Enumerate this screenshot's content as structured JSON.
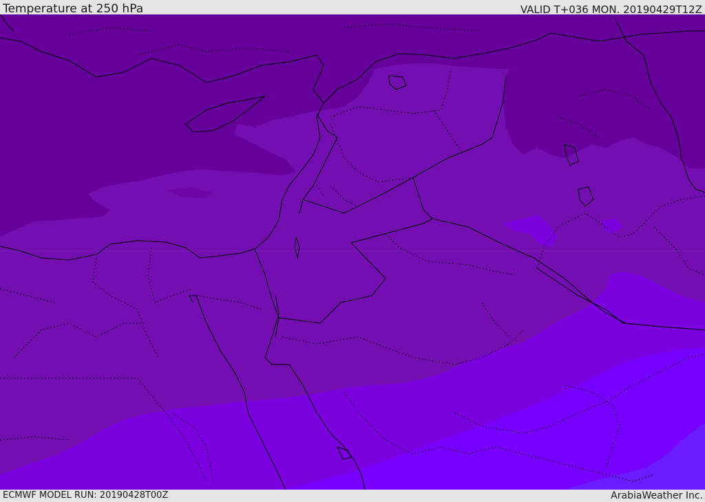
{
  "header": {
    "title": "Temperature at 250 hPa",
    "valid": "VALID T+036 MON. 20190429T12Z"
  },
  "footer": {
    "model_run": "ECMWF MODEL RUN: 20190428T00Z",
    "credit": "ArabiaWeather Inc."
  },
  "colors": {
    "band_darkest": "#65009a",
    "band_dark": "#720ba9",
    "band_mid": "#7a07c4",
    "band_bright": "#7e00e8",
    "band_brightest": "#7a00ff",
    "band_blueish": "#6a1cff",
    "coastline": "#000000"
  }
}
